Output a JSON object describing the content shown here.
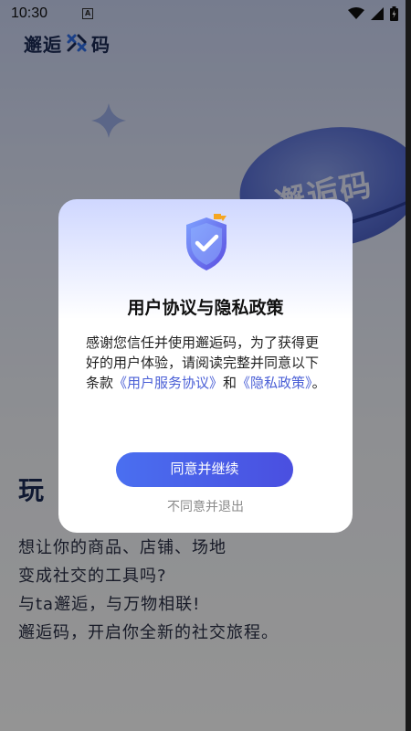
{
  "status_bar": {
    "time": "10:30",
    "notification_icon": "a-notification-icon",
    "icons": [
      "wifi-icon",
      "signal-icon",
      "battery-icon"
    ]
  },
  "app": {
    "logo_text_left": "邂逅",
    "logo_text_right": "码",
    "planet_text": "邂逅码"
  },
  "hero": {
    "title_visible": "玩",
    "lines": [
      "想让你的商品、店铺、场地",
      "变成社交的工具吗?",
      "与ta邂逅，与万物相联!",
      "邂逅码，开启你全新的社交旅程。"
    ]
  },
  "dialog": {
    "title": "用户协议与隐私政策",
    "body_prefix": "感谢您信任并使用邂逅码，为了获得更好的用户体验，请阅读完整并同意以下条款",
    "link_service": "《用户服务协议》",
    "conjunction": "和",
    "link_privacy": "《隐私政策》",
    "body_suffix": "。",
    "agree_label": "同意并继续",
    "disagree_label": "不同意并退出"
  },
  "colors": {
    "accent": "#4a5fd6",
    "button_start": "#4a6ff0",
    "button_end": "#4a4fe0",
    "overlay": "rgba(0,0,0,0.42)"
  }
}
